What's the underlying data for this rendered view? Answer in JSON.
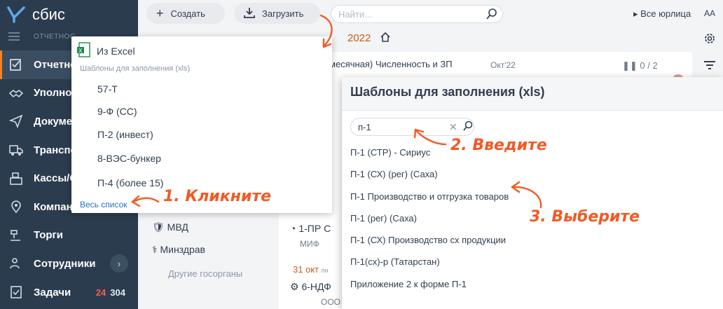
{
  "app": {
    "logo_text": "сбис"
  },
  "sidebar": {
    "section_label": "ОТЧЕТНОС",
    "items": [
      {
        "label": "Отчетно",
        "icon": "report-icon",
        "active": true
      },
      {
        "label": "Уполном",
        "icon": "handshake-icon"
      },
      {
        "label": "Докуме",
        "icon": "paper-plane-icon"
      },
      {
        "label": "Транспо",
        "icon": "truck-icon"
      },
      {
        "label": "Кассы/С",
        "icon": "cash-register-icon"
      },
      {
        "label": "Компани",
        "icon": "location-icon"
      },
      {
        "label": "Торги",
        "icon": "auction-icon"
      },
      {
        "label": "Сотрудники",
        "icon": "people-icon",
        "chevron": "›"
      },
      {
        "label": "Задачи",
        "icon": "tasks-icon",
        "badge_red": "24",
        "badge_white": "304"
      }
    ]
  },
  "toolbar": {
    "create_label": "Создать",
    "upload_label": "Загрузить",
    "search_placeholder": "Найти...",
    "org_label": "Все юрлица",
    "font_label": "AA"
  },
  "content": {
    "year": "2022",
    "report_title": "месячная) Численность и ЗП",
    "report_date": "Окт'22",
    "report_count": "0 / 2",
    "bg_org_1": "МВД",
    "bg_org_2": "Минздрав",
    "bg_org_3": "Другие госорганы",
    "bg_report_a": "1-ПР С",
    "bg_report_a2": "МИФ",
    "bg_date": "31 окт",
    "bg_date_suffix": "пн",
    "bg_report_b": "6-НДФ",
    "bg_report_b2": "ООО"
  },
  "dropdown": {
    "excel_label": "Из Excel",
    "section_label": "Шаблоны для заполнения (xls)",
    "items": [
      "57-Т",
      "9-Ф (СС)",
      "П-2 (инвест)",
      "8-ВЭС-бункер",
      "П-4 (более 15)"
    ],
    "all_label": "Весь список"
  },
  "dialog": {
    "title": "Шаблоны для заполнения (xls)",
    "search_value": "п-1",
    "items": [
      "П-1 (СТР) - Сириус",
      "П-1 (СХ) (рег) (Саха)",
      "П-1 Производство и отгрузка товаров",
      "П-1 (рег) (Саха)",
      "П-1 (СХ) Производство сх продукции",
      "П-1(сх)-р (Татарстан)",
      "Приложение 2 к форме П-1"
    ]
  },
  "annotations": {
    "step1": "1. Кликните",
    "step2": "2. Введите",
    "step3": "3. Выберите"
  },
  "colors": {
    "sidebar": "#2b3c4f",
    "accent": "#f15a24",
    "link": "#2573c1"
  }
}
